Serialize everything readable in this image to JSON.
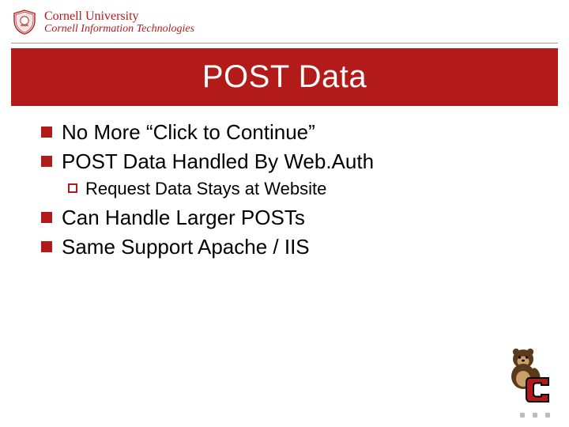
{
  "brand": {
    "university": "Cornell University",
    "department": "Cornell Information Technologies"
  },
  "title": "POST Data",
  "bullets": [
    {
      "text": "No More “Click to Continue”"
    },
    {
      "text": "POST Data Handled By Web.Auth",
      "sub": [
        {
          "text": "Request Data Stays at Website"
        }
      ]
    },
    {
      "text": "Can Handle Larger POSTs"
    },
    {
      "text": "Same Support Apache / IIS"
    }
  ],
  "colors": {
    "cornell_red": "#b31b1b"
  }
}
